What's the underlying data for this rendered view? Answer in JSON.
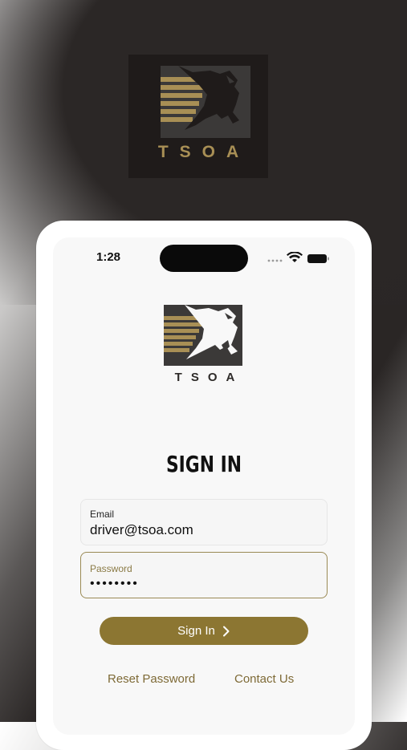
{
  "hero": {
    "logo_icon": "eagle-speed-icon",
    "wordmark": "TSOA"
  },
  "status_bar": {
    "time": "1:28",
    "icons": [
      "signal-icon",
      "wifi-icon",
      "battery-icon"
    ]
  },
  "app": {
    "logo_icon": "eagle-speed-icon",
    "wordmark": "TSOA",
    "title": "SIGN IN"
  },
  "form": {
    "email": {
      "label": "Email",
      "value": "driver@tsoa.com"
    },
    "password": {
      "label": "Password",
      "value": "••••••••"
    },
    "submit_label": "Sign In",
    "submit_icon": "chevron-right-icon"
  },
  "links": {
    "reset_password": "Reset Password",
    "contact_us": "Contact Us"
  },
  "colors": {
    "accent": "#8c7632",
    "gold": "#a88f55",
    "dark": "#2b2726"
  }
}
